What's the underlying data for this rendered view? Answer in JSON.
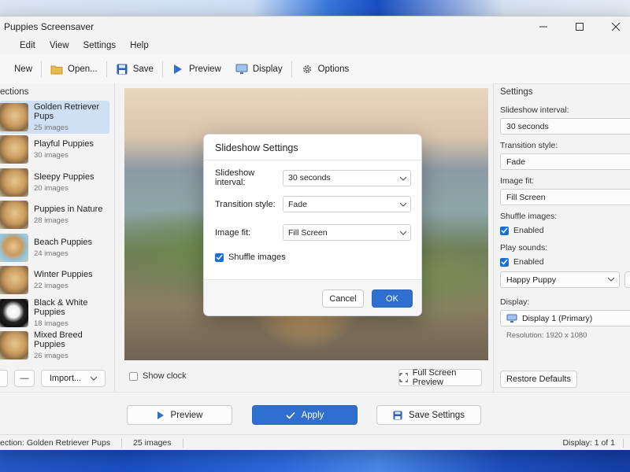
{
  "window": {
    "title": "Puppies Screensaver"
  },
  "menu": [
    "Edit",
    "View",
    "Settings",
    "Help"
  ],
  "toolbar": {
    "new": "New",
    "open": "Open...",
    "save": "Save",
    "preview": "Preview",
    "display": "Display",
    "options": "Options"
  },
  "sidebar": {
    "header": "ections",
    "items": [
      {
        "name": "Golden Retriever Pups",
        "count": "25 images",
        "selected": true
      },
      {
        "name": "Playful Puppies",
        "count": "30 images"
      },
      {
        "name": "Sleepy Puppies",
        "count": "20 images"
      },
      {
        "name": "Puppies in Nature",
        "count": "28 images"
      },
      {
        "name": "Beach Puppies",
        "count": "24 images"
      },
      {
        "name": "Winter Puppies",
        "count": "22 images"
      },
      {
        "name": "Black & White Puppies",
        "count": "18 images"
      },
      {
        "name": "Mixed Breed Puppies",
        "count": "26 images"
      }
    ],
    "remove_label": "—",
    "import_label": "Import..."
  },
  "center": {
    "show_clock": "Show clock",
    "full_screen_preview": "Full Screen Preview"
  },
  "settings": {
    "header": "Settings",
    "interval_label": "Slideshow interval:",
    "interval_value": "30 seconds",
    "transition_label": "Transition style:",
    "transition_value": "Fade",
    "fit_label": "Image fit:",
    "fit_value": "Fill Screen",
    "shuffle_label": "Shuffle images:",
    "shuffle_value": "Enabled",
    "sounds_label": "Play sounds:",
    "sounds_value": "Enabled",
    "sound_choice": "Happy Puppy",
    "display_label": "Display:",
    "display_value": "Display 1 (Primary)",
    "resolution": "Resolution: 1920 x 1080",
    "restore_defaults": "Restore Defaults"
  },
  "bottom": {
    "preview": "Preview",
    "apply": "Apply",
    "save_settings": "Save Settings"
  },
  "status": {
    "collection": "ection: Golden Retriever Pups",
    "count": "25 images",
    "display": "Display: 1 of 1"
  },
  "dialog": {
    "title": "Slideshow Settings",
    "interval_label": "Slideshow interval:",
    "interval_value": "30 seconds",
    "transition_label": "Transition style:",
    "transition_value": "Fade",
    "fit_label": "Image fit:",
    "fit_value": "Fill Screen",
    "shuffle_label": "Shuffle images",
    "cancel": "Cancel",
    "ok": "OK"
  },
  "colors": {
    "accent": "#2f6fcf",
    "selection": "#cfe0f5",
    "checkbox": "#1a6fd4"
  }
}
